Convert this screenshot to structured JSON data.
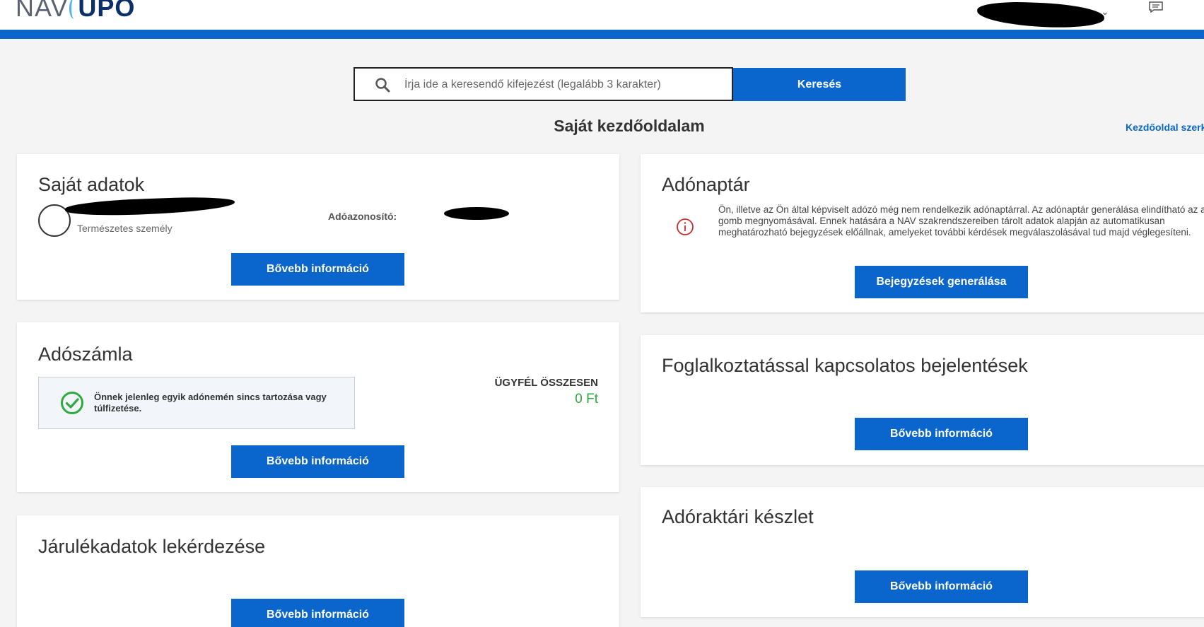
{
  "header": {
    "logo_left": "NAV",
    "logo_right": "UPO",
    "chevron": "⌄",
    "chat_icon": "chat-icon"
  },
  "search": {
    "placeholder": "Írja ide a keresendő kifejezést (legalább 3 karakter)",
    "value": "",
    "button_label": "Keresés"
  },
  "page": {
    "title": "Saját kezdőoldalam",
    "edit_link": "Kezdőoldal szerk"
  },
  "cards": {
    "personal": {
      "title": "Saját adatok",
      "person_type": "Természetes személy",
      "tax_id_label": "Adóazonosító:",
      "button": "Bővebb információ"
    },
    "tax_account": {
      "title": "Adószámla",
      "status_text": "Önnek jelenleg egyik adónemén sincs tartozása vagy túlfizetése.",
      "total_label": "ÜGYFÉL ÖSSZESEN",
      "total_value": "0 Ft",
      "button": "Bővebb információ"
    },
    "contributions": {
      "title": "Járulékadatok lekérdezése",
      "button": "Bővebb információ"
    },
    "tax_calendar": {
      "title": "Adónaptár",
      "text": "Ön, illetve az Ön által képviselt adózó még nem rendelkezik adónaptárral. Az adónaptár generálása elindítható az alábbi gomb megnyomásával. Ennek hatására a NAV szakrendszereiben tárolt adatok alapján az automatikusan meghatározható bejegyzések előállnak, amelyeket további kérdések megválaszolásával tud majd véglegesíteni.",
      "button": "Bejegyzések generálása"
    },
    "employment": {
      "title": "Foglalkoztatással kapcsolatos bejelentések",
      "button": "Bővebb információ"
    },
    "warehouse": {
      "title": "Adóraktári készlet",
      "button": "Bővebb információ"
    }
  },
  "colors": {
    "accent": "#0a66cc",
    "success": "#2eaa3e",
    "warning": "#cc2b2b"
  }
}
